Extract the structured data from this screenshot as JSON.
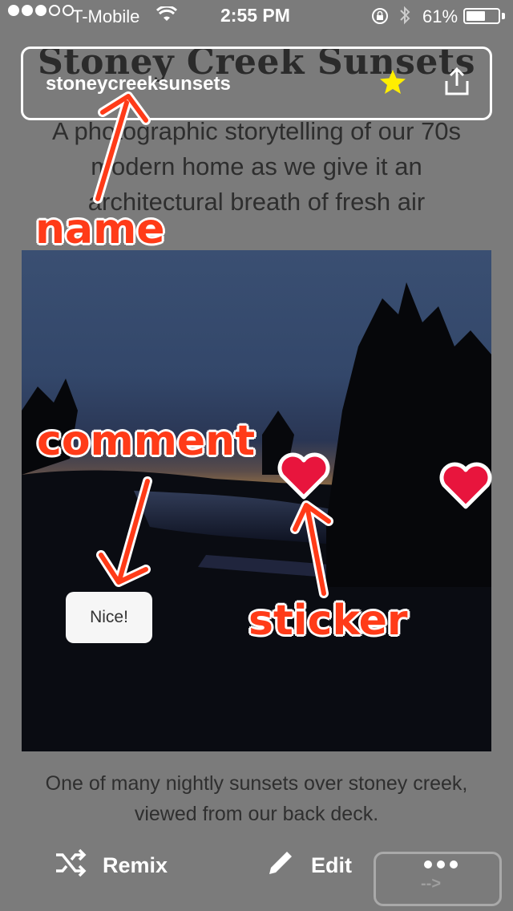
{
  "status_bar": {
    "carrier": "T-Mobile",
    "time": "2:55 PM",
    "battery_percent": "61%",
    "battery_level": 0.61,
    "signal_bars_filled": 3,
    "signal_bars_total": 5
  },
  "story": {
    "title": "Stoney Creek Sunsets",
    "subtitle": "A photographic storytelling of our 70s modern home as we give it an architectural breath of fresh air",
    "caption": "One of many nightly sunsets over stoney creek, viewed from our back deck."
  },
  "header_bar": {
    "username": "stoneycreeksunsets",
    "star_icon": "star-icon",
    "share_icon": "share-icon"
  },
  "photo": {
    "comment": "Nice!",
    "sticker_icon": "heart-icon"
  },
  "annotations": {
    "name": "name",
    "comment": "comment",
    "sticker": "sticker"
  },
  "bottom_bar": {
    "remix_label": "Remix",
    "edit_label": "Edit",
    "more_arrow": "-->",
    "remix_icon": "shuffle-icon",
    "edit_icon": "pencil-icon",
    "more_icon": "more-dots-icon"
  },
  "colors": {
    "annotation": "#ff3b18",
    "star": "#ffee00",
    "heart": "#e8153d"
  }
}
